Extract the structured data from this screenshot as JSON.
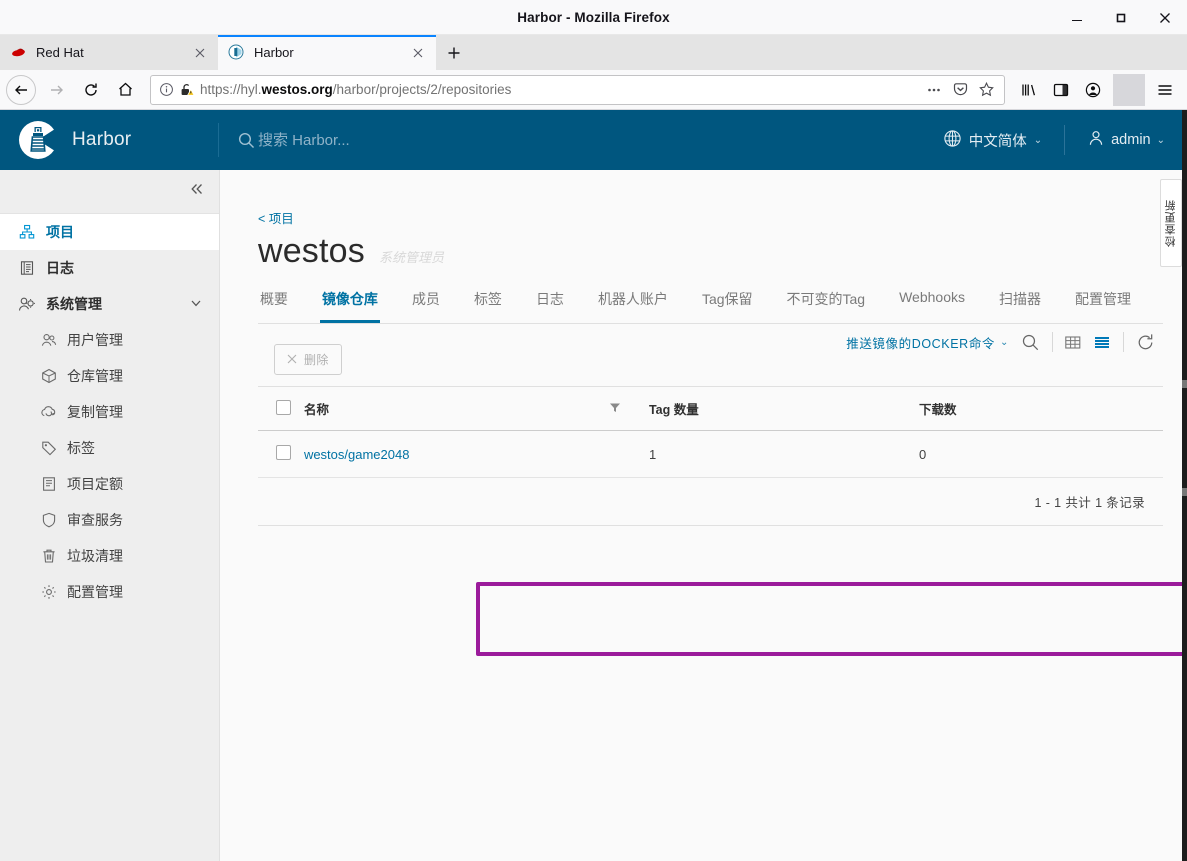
{
  "browser": {
    "window_title": "Harbor - Mozilla Firefox",
    "minimize_label": "−",
    "maximize_label": "▢",
    "close_label": "✕",
    "tabs": [
      {
        "title": "Red Hat",
        "favicon": "redhat-icon",
        "active": false
      },
      {
        "title": "Harbor",
        "favicon": "harbor-icon",
        "active": true
      }
    ],
    "new_tab_label": "+",
    "url_prefix": "https://hyl.",
    "url_domain": "westos.org",
    "url_path": "/harbor/projects/2/repositories",
    "identity_icon": "info-circle-icon",
    "lock_icon": "broken-lock-warning-icon",
    "page_actions_icon": "ellipsis-icon",
    "pocket_icon": "pocket-icon",
    "bookmark_icon": "star-icon",
    "library_icon": "library-icon",
    "sidebar_icon": "sidebar-icon",
    "account_icon": "account-icon",
    "menu_icon": "hamburger-menu-icon"
  },
  "app": {
    "brand": "Harbor",
    "logo_icon": "harbor-lighthouse-logo",
    "search_placeholder": "搜索 Harbor...",
    "search_value": "",
    "language": "中文简体",
    "language_icon": "globe-icon",
    "user": "admin",
    "user_icon": "user-icon",
    "collapse_icon": "double-chevron-left-icon"
  },
  "sidebar": {
    "items": [
      {
        "label": "项目",
        "icon": "project-nodes-icon",
        "selected": true,
        "sub": false
      },
      {
        "label": "日志",
        "icon": "log-list-icon",
        "selected": false,
        "sub": false
      },
      {
        "label": "系统管理",
        "icon": "user-cog-icon",
        "selected": false,
        "sub": false,
        "expandable": true
      },
      {
        "label": "用户管理",
        "icon": "users-icon",
        "sub": true
      },
      {
        "label": "仓库管理",
        "icon": "box-icon",
        "sub": true
      },
      {
        "label": "复制管理",
        "icon": "cloud-sync-icon",
        "sub": true
      },
      {
        "label": "标签",
        "icon": "tag-icon",
        "sub": true
      },
      {
        "label": "项目定额",
        "icon": "quota-icon",
        "sub": true
      },
      {
        "label": "审查服务",
        "icon": "shield-icon",
        "sub": true
      },
      {
        "label": "垃圾清理",
        "icon": "trash-icon",
        "sub": true
      },
      {
        "label": "配置管理",
        "icon": "gear-icon",
        "sub": true
      }
    ]
  },
  "main": {
    "breadcrumb": "< 项目",
    "project_name": "westos",
    "project_role": "系统管理员",
    "tabs": [
      {
        "label": "概要",
        "active": false
      },
      {
        "label": "镜像仓库",
        "active": true
      },
      {
        "label": "成员",
        "active": false
      },
      {
        "label": "标签",
        "active": false
      },
      {
        "label": "日志",
        "active": false
      },
      {
        "label": "机器人账户",
        "active": false
      },
      {
        "label": "Tag保留",
        "active": false
      },
      {
        "label": "不可变的Tag",
        "active": false
      },
      {
        "label": "Webhooks",
        "active": false
      },
      {
        "label": "扫描器",
        "active": false
      },
      {
        "label": "配置管理",
        "active": false
      }
    ],
    "toolbar": {
      "delete_label": "删除",
      "delete_icon": "close-x-icon",
      "docker_command_label": "推送镜像的DOCKER命令",
      "docker_command_caret": "⌄",
      "search_icon": "magnifier-icon",
      "view_toggle_grid_icon": "grid-view-icon",
      "view_toggle_list_icon": "list-view-icon",
      "refresh_icon": "refresh-icon"
    },
    "table": {
      "columns": [
        "名称",
        "Tag 数量",
        "下载数"
      ],
      "sort_icon": "filter-funnel-icon",
      "rows": [
        {
          "name": "westos/game2048",
          "tag_count": "1",
          "download_count": "0"
        }
      ],
      "footer": "1 - 1 共计 1 条记录"
    },
    "side_tab_text": "检查更新"
  }
}
